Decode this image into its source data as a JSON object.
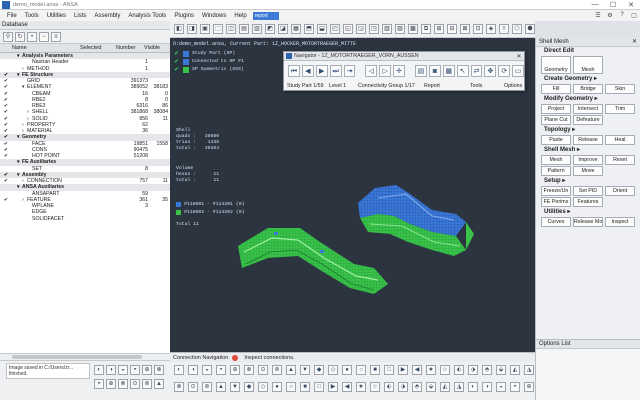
{
  "window": {
    "title": "demo_model.ansa - ANSA",
    "min": "—",
    "max": "☐",
    "close": "✕"
  },
  "menu": {
    "items": [
      "File",
      "Tools",
      "Utilities",
      "Lists",
      "Assembly",
      "Analysis Tools",
      "Plugins",
      "Windows",
      "Help"
    ],
    "search": "report",
    "right_icons": [
      "☰",
      "⚙",
      "?",
      "▢"
    ]
  },
  "database": {
    "title": "Database",
    "columns": {
      "name": "Name",
      "selected": "Selected",
      "number": "Number",
      "visible": "Visible"
    },
    "rows": [
      {
        "check": "",
        "name": "Analysis Parameters",
        "group": true,
        "indent": 1,
        "arrow": "▾",
        "sel": "",
        "num": "",
        "vis": ""
      },
      {
        "check": "",
        "name": "Nastran Header",
        "group": false,
        "indent": 3,
        "arrow": "",
        "sel": "",
        "num": "1",
        "vis": ""
      },
      {
        "check": "",
        "name": "METHOD",
        "group": false,
        "indent": 2,
        "arrow": "›",
        "sel": "",
        "num": "1",
        "vis": ""
      },
      {
        "check": "✔",
        "name": "FE Structure",
        "group": true,
        "indent": 1,
        "arrow": "▾",
        "sel": "",
        "num": "",
        "vis": ""
      },
      {
        "check": "✔",
        "name": "GRID",
        "group": false,
        "indent": 2,
        "arrow": "",
        "sel": "",
        "num": "391373",
        "vis": ""
      },
      {
        "check": "✔",
        "name": "ELEMENT",
        "group": false,
        "indent": 2,
        "arrow": "▾",
        "sel": "",
        "num": "389052",
        "vis": "38183"
      },
      {
        "check": "✔",
        "name": "CBEAM",
        "group": false,
        "indent": 3,
        "arrow": "",
        "sel": "",
        "num": "16",
        "vis": "0"
      },
      {
        "check": "✔",
        "name": "RBE2",
        "group": false,
        "indent": 3,
        "arrow": "",
        "sel": "",
        "num": "8",
        "vis": "0"
      },
      {
        "check": "✔",
        "name": "RBE3",
        "group": false,
        "indent": 3,
        "arrow": "",
        "sel": "",
        "num": "6316",
        "vis": "86"
      },
      {
        "check": "✔",
        "name": "SHELL",
        "group": false,
        "indent": 3,
        "arrow": "›",
        "sel": "",
        "num": "381868",
        "vis": "38084"
      },
      {
        "check": "✔",
        "name": "SOLID",
        "group": false,
        "indent": 3,
        "arrow": "›",
        "sel": "",
        "num": "856",
        "vis": "11"
      },
      {
        "check": "✔",
        "name": "PROPERTY",
        "group": false,
        "indent": 2,
        "arrow": "›",
        "sel": "",
        "num": "62",
        "vis": ""
      },
      {
        "check": "✔",
        "name": "MATERIAL",
        "group": false,
        "indent": 2,
        "arrow": "›",
        "sel": "",
        "num": "36",
        "vis": ""
      },
      {
        "check": "✔",
        "name": "Geometry",
        "group": true,
        "indent": 1,
        "arrow": "▾",
        "sel": "",
        "num": "",
        "vis": ""
      },
      {
        "check": "✔",
        "name": "FACE",
        "group": false,
        "indent": 3,
        "arrow": "",
        "sel": "",
        "num": "19851",
        "vis": "1558"
      },
      {
        "check": "✔",
        "name": "CONS",
        "group": false,
        "indent": 3,
        "arrow": "",
        "sel": "",
        "num": "90475",
        "vis": ""
      },
      {
        "check": "✔",
        "name": "HOT POINT",
        "group": false,
        "indent": 3,
        "arrow": "",
        "sel": "",
        "num": "51208",
        "vis": ""
      },
      {
        "check": "",
        "name": "FE Auxiliaries",
        "group": true,
        "indent": 1,
        "arrow": "▾",
        "sel": "",
        "num": "",
        "vis": ""
      },
      {
        "check": "",
        "name": "SET",
        "group": false,
        "indent": 3,
        "arrow": "",
        "sel": "",
        "num": "8",
        "vis": ""
      },
      {
        "check": "✔",
        "name": "Assembly",
        "group": true,
        "indent": 1,
        "arrow": "▾",
        "sel": "",
        "num": "",
        "vis": ""
      },
      {
        "check": "✔",
        "name": "CONNECTION",
        "group": false,
        "indent": 2,
        "arrow": "›",
        "sel": "",
        "num": "757",
        "vis": "11"
      },
      {
        "check": "",
        "name": "ANSA Auxiliaries",
        "group": true,
        "indent": 1,
        "arrow": "▾",
        "sel": "",
        "num": "",
        "vis": ""
      },
      {
        "check": "",
        "name": "ANSAPART",
        "group": false,
        "indent": 3,
        "arrow": "",
        "sel": "",
        "num": "59",
        "vis": ""
      },
      {
        "check": "✔",
        "name": "FEATURE",
        "group": false,
        "indent": 2,
        "arrow": "›",
        "sel": "",
        "num": "361",
        "vis": "35"
      },
      {
        "check": "",
        "name": "WPLANE",
        "group": false,
        "indent": 3,
        "arrow": "",
        "sel": "",
        "num": "3",
        "vis": ""
      },
      {
        "check": "",
        "name": "EDGE",
        "group": false,
        "indent": 3,
        "arrow": "",
        "sel": "",
        "num": "",
        "vis": ""
      },
      {
        "check": "",
        "name": "SOLIDFACET",
        "group": false,
        "indent": 3,
        "arrow": "",
        "sel": "",
        "num": "",
        "vis": ""
      }
    ],
    "log": "Image saved in C:/Users/zr... finished."
  },
  "viewport": {
    "header": "D:demo_model.ansa,  Current Part: 1Z_HOCKER_MOTORTRAEGER_MITTE",
    "checks": [
      {
        "label": "Study Part (SP)",
        "color": "#3a78d8"
      },
      {
        "label": "Connected to SP #1",
        "color": "#3a78d8"
      },
      {
        "label": "SP Symmetric (SSS)",
        "color": "#38c24a"
      }
    ],
    "stats_shell": "Shell\nquads :   38080\ntrias :    1436\ntotal :   39384",
    "stats_volume": "Volume\nhexas :      11\ntotal :      11",
    "ids": [
      {
        "text": "#110801 - #114201 (0)",
        "color": "#3a78d8"
      },
      {
        "text": "#110802 - #114202 (0)",
        "color": "#38c24a"
      }
    ],
    "total": "Total 11"
  },
  "navigator": {
    "title": "Navigator - 1Z_MOTORTRAEGER_VORN_AUSSEN",
    "close": "✕",
    "labels": {
      "study_part": "Study Part 1/59",
      "level": "Level 1",
      "conn_group": "Connectivity Group 1/17",
      "report": "Report",
      "tools": "Tools",
      "options": "Options"
    }
  },
  "status": {
    "label": "Connection Navigation",
    "message": "Inspect connections."
  },
  "right_panel": {
    "title": "Shell Mesh",
    "close": "✕",
    "sections": [
      {
        "title": "Direct Edit",
        "buttons": [
          "Geometry",
          "Mesh"
        ]
      },
      {
        "title": "Create Geometry ▸",
        "buttons": [
          "Fill",
          "Bridge",
          "Skin"
        ]
      },
      {
        "title": "Modify Geometry ▸",
        "buttons": [
          "Project",
          "Intersect",
          "Trim",
          "Plane Cut",
          "Defeature"
        ]
      },
      {
        "title": "Topology ▸",
        "buttons": [
          "Paste",
          "Release",
          "Heal"
        ]
      },
      {
        "title": "Shell Mesh ▸",
        "buttons": [
          "Mesh",
          "Improve",
          "Reset",
          "Pattern",
          "Move"
        ]
      },
      {
        "title": "Setup ▸",
        "buttons": [
          "Freeze/Un",
          "Set PID",
          "Orient",
          "FE Perims",
          "Features"
        ]
      },
      {
        "title": "Utilities ▸",
        "buttons": [
          "Curves",
          "Release Mo.",
          "Inspect"
        ]
      }
    ],
    "options_list": "Options List"
  },
  "colors": {
    "accent": "#2a63b0",
    "viewport_bg": "#2c3440",
    "shell_green": "#38c24a",
    "shell_blue": "#3a78d8"
  }
}
